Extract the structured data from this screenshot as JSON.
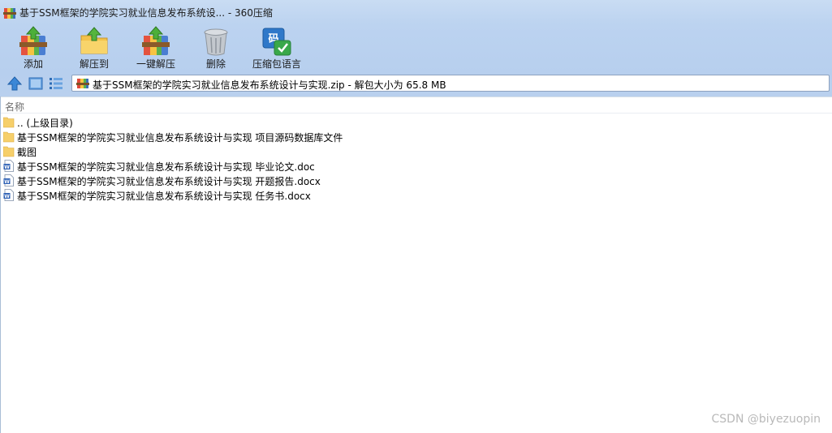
{
  "window": {
    "title": "基于SSM框架的学院实习就业信息发布系统设... - 360压缩"
  },
  "toolbar": {
    "items": [
      {
        "label": "添加",
        "icon": "add-archive-icon"
      },
      {
        "label": "解压到",
        "icon": "extract-to-icon"
      },
      {
        "label": "一键解压",
        "icon": "one-click-extract-icon"
      },
      {
        "label": "删除",
        "icon": "trash-icon"
      },
      {
        "label": "压缩包语言",
        "icon": "archive-language-icon"
      }
    ]
  },
  "address_bar": {
    "path": "基于SSM框架的学院实习就业信息发布系统设计与实现.zip - 解包大小为 65.8 MB"
  },
  "file_list": {
    "column_name": "名称",
    "rows": [
      {
        "name": ".. (上级目录)",
        "type": "folder"
      },
      {
        "name": "基于SSM框架的学院实习就业信息发布系统设计与实现 项目源码数据库文件",
        "type": "folder"
      },
      {
        "name": "截图",
        "type": "folder"
      },
      {
        "name": "基于SSM框架的学院实习就业信息发布系统设计与实现 毕业论文.doc",
        "type": "word-doc"
      },
      {
        "name": "基于SSM框架的学院实习就业信息发布系统设计与实现 开题报告.docx",
        "type": "word-doc"
      },
      {
        "name": "基于SSM框架的学院实习就业信息发布系统设计与实现 任务书.docx",
        "type": "word-doc"
      }
    ]
  },
  "watermark": "CSDN @biyezuopin"
}
